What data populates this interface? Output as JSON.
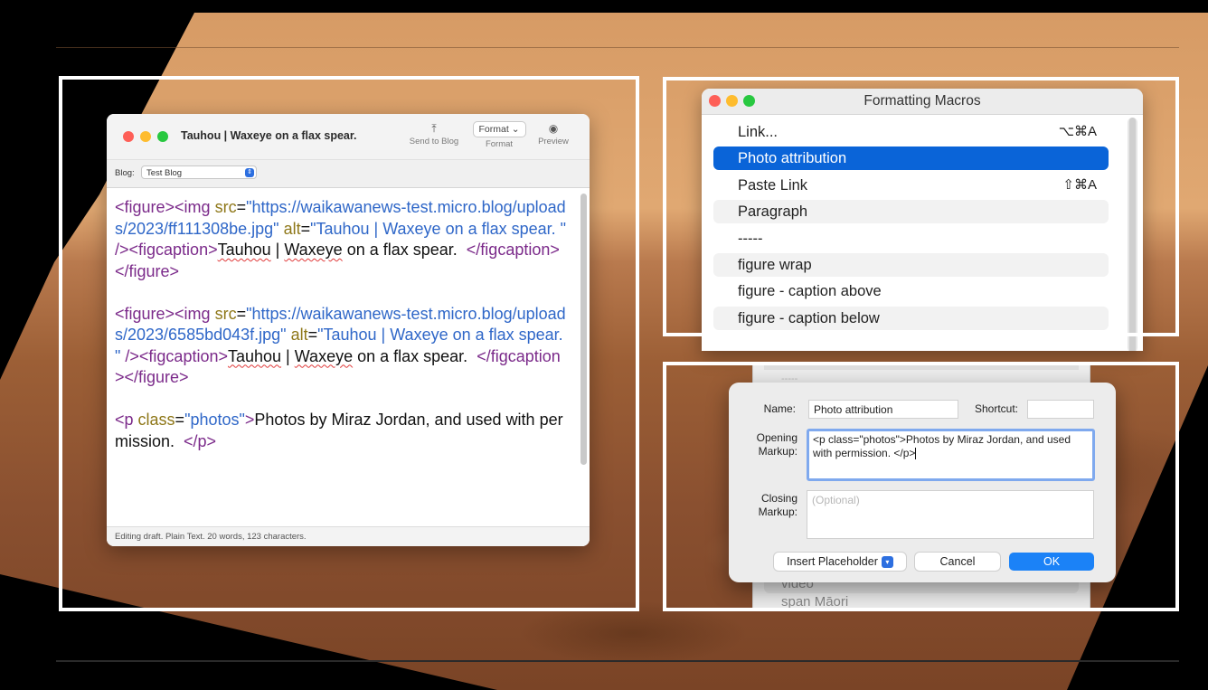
{
  "editor": {
    "title": "Tauhou | Waxeye on a flax spear.",
    "toolbar": {
      "send_to_blog": "Send to Blog",
      "format_menu": "Format",
      "format_label": "Format",
      "preview": "Preview"
    },
    "blog_label": "Blog:",
    "blog_value": "Test Blog",
    "status": "Editing draft. Plain Text. 20 words, 123 characters."
  },
  "macros": {
    "title": "Formatting Macros",
    "items": [
      {
        "label": "Link...",
        "shortcut": "⌥⌘A"
      },
      {
        "label": "Photo attribution",
        "shortcut": ""
      },
      {
        "label": "Paste Link",
        "shortcut": "⇧⌘A"
      },
      {
        "label": "Paragraph",
        "shortcut": ""
      },
      {
        "label": "-----",
        "shortcut": ""
      },
      {
        "label": "figure wrap",
        "shortcut": ""
      },
      {
        "label": "figure - caption above",
        "shortcut": ""
      },
      {
        "label": "figure - caption below",
        "shortcut": ""
      }
    ],
    "selected_item": "Photo attribution"
  },
  "behind_list": {
    "partial_top": "-----",
    "item_video": "video",
    "item_span": "span Māori"
  },
  "dialog": {
    "name_label": "Name:",
    "name_value": "Photo attribution",
    "shortcut_label": "Shortcut:",
    "shortcut_value": "",
    "opening_label_1": "Opening",
    "opening_label_2": "Markup:",
    "opening_value": "<p class=\"photos\">Photos by Miraz Jordan, and used with permission.  </p>",
    "closing_label_1": "Closing",
    "closing_label_2": "Markup:",
    "closing_placeholder": "(Optional)",
    "insert_placeholder": "Insert Placeholder",
    "cancel": "Cancel",
    "ok": "OK"
  },
  "colors": {
    "selection_blue": "#0a64d8",
    "ok_button": "#1b82f7",
    "tag_purple": "#7b2a8a",
    "attr_olive": "#8e7718",
    "string_blue": "#2f67c8"
  }
}
